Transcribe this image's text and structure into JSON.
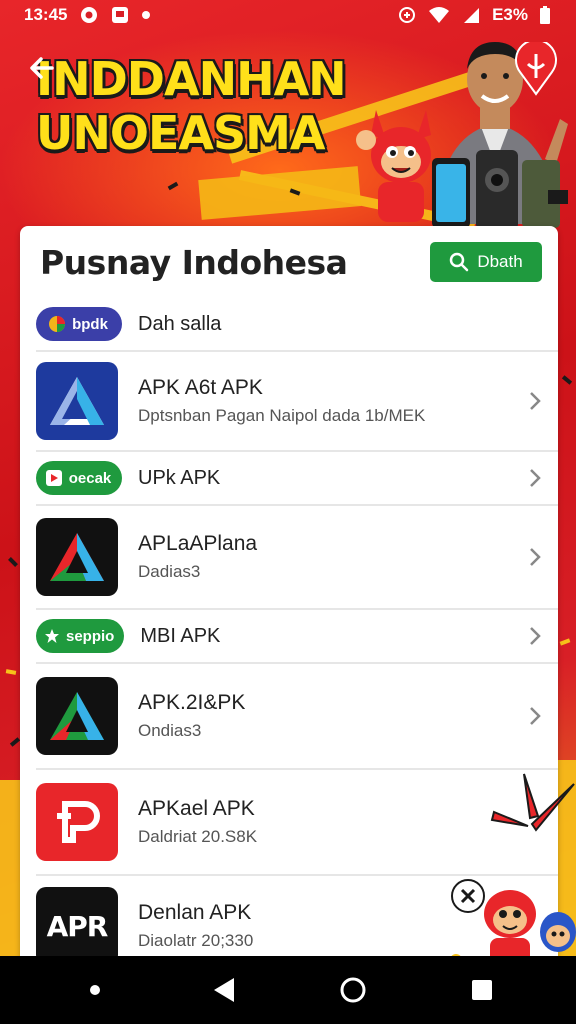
{
  "status_bar": {
    "time": "13:45",
    "battery": "E3%"
  },
  "banner": {
    "title_line1": "INDDANHAN",
    "title_line2": "UNOEASMA"
  },
  "card": {
    "title": "Pusnay Indohesa",
    "search_button_label": "Dbath"
  },
  "rows": [
    {
      "kind": "pill",
      "pill_label": "bpdk",
      "pill_color": "#3b3fa8",
      "label": "Dah salla"
    },
    {
      "kind": "app",
      "icon": "blue-triangle-icon",
      "title": "APK A6t APK",
      "subtitle": "Dptsnban Pagan Naipol dada 1b/MEK"
    },
    {
      "kind": "pill",
      "pill_label": "oecak",
      "pill_color": "#1f9a3e",
      "label": "UPk APK"
    },
    {
      "kind": "app",
      "icon": "black-triangle-icon",
      "title": "APLaAPlana",
      "subtitle": "Dadias3"
    },
    {
      "kind": "pill",
      "pill_label": "seppio",
      "pill_color": "#1f9a3e",
      "label": "MBI APK"
    },
    {
      "kind": "app",
      "icon": "black-triangle-green-icon",
      "title": "APK.2I&PK",
      "subtitle": "Ondias3"
    },
    {
      "kind": "app",
      "icon": "red-p-logo-icon",
      "title": "APKael APK",
      "subtitle": "Daldriat 20.S8K"
    },
    {
      "kind": "app",
      "icon": "apr-logo-icon",
      "icon_text": "APR",
      "title": "Denlan APK",
      "subtitle": "Diaolatr 20;330"
    }
  ],
  "colors": {
    "brand_red": "#d81f26",
    "accent_yellow": "#ffe01a",
    "search_green": "#1f9a3e"
  }
}
